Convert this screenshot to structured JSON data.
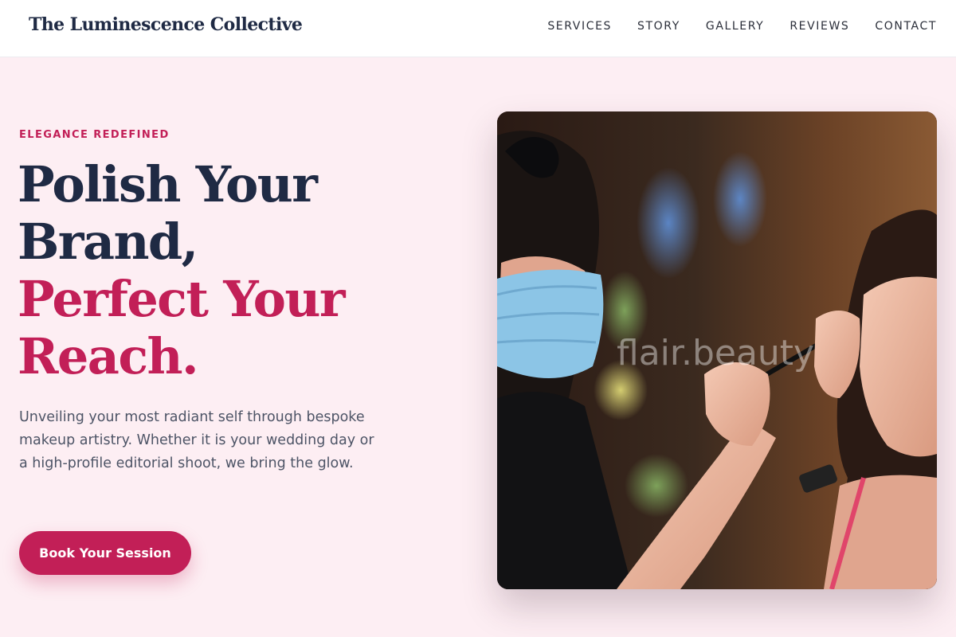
{
  "header": {
    "brand": "The Luminescence Collective",
    "nav": [
      "SERVICES",
      "STORY",
      "GALLERY",
      "REVIEWS",
      "CONTACT"
    ]
  },
  "hero": {
    "eyebrow": "ELEGANCE REDEFINED",
    "headline_dark": [
      "Polish Your",
      "Brand,"
    ],
    "headline_accent": [
      "Perfect Your",
      "Reach."
    ],
    "lede": "Unveiling your most radiant self through bespoke makeup artistry. Whether it is your wedding day or a high-profile editorial shoot, we bring the glow.",
    "cta_label": "Book Your Session",
    "photo_watermark": "flair.beauty"
  },
  "colors": {
    "accent": "#c21f57",
    "ink": "#1f2a44",
    "page_bg": "#fdeef3"
  }
}
